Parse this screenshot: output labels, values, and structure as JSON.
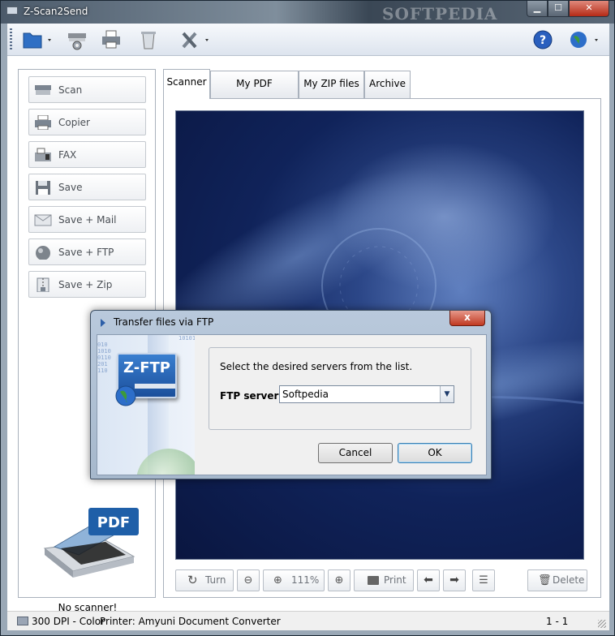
{
  "window": {
    "title": "Z-Scan2Send",
    "watermark": "SOFTPEDIA"
  },
  "toolbar": {
    "icons": [
      "folder-icon",
      "scanner-settings-icon",
      "printer-icon",
      "recycle-bin-icon",
      "tools-icon",
      "help-icon",
      "globe-icon"
    ]
  },
  "sidebar": {
    "items": [
      {
        "label": "Scan",
        "icon": "scanner-icon"
      },
      {
        "label": "Copier",
        "icon": "copier-icon"
      },
      {
        "label": "FAX",
        "icon": "fax-icon"
      },
      {
        "label": "Save",
        "icon": "floppy-icon"
      },
      {
        "label": "Save + Mail",
        "icon": "mail-icon"
      },
      {
        "label": "Save + FTP",
        "icon": "sphere-icon"
      },
      {
        "label": "Save + Zip",
        "icon": "zip-icon"
      }
    ],
    "pdf_badge": "PDF",
    "scanner_status": "No scanner!"
  },
  "tabs": [
    "Scanner",
    "My PDF documents",
    "My ZIP files",
    "Archive"
  ],
  "bottom_bar": {
    "turn": "Turn",
    "zoom": "111%",
    "print": "Print",
    "delete": "Delete"
  },
  "status": {
    "resolution": "300 DPI - Color",
    "printer": "Printer: Amyuni Document Converter",
    "page": "1 - 1"
  },
  "dialog": {
    "title": "Transfer files via FTP",
    "close": "x",
    "logo_text": "Z-FTP",
    "binary_text": [
      "10101",
      "010",
      "1010",
      "0110",
      "201",
      "110"
    ],
    "instruction": "Select the desired servers from the list.",
    "ftp_label": "FTP server:",
    "ftp_value": "Softpedia",
    "cancel": "Cancel",
    "ok": "OK"
  },
  "colors": {
    "accent": "#2d5fa8",
    "preview_dark": "#0a1640",
    "title_bar": "#4b5a6a"
  }
}
